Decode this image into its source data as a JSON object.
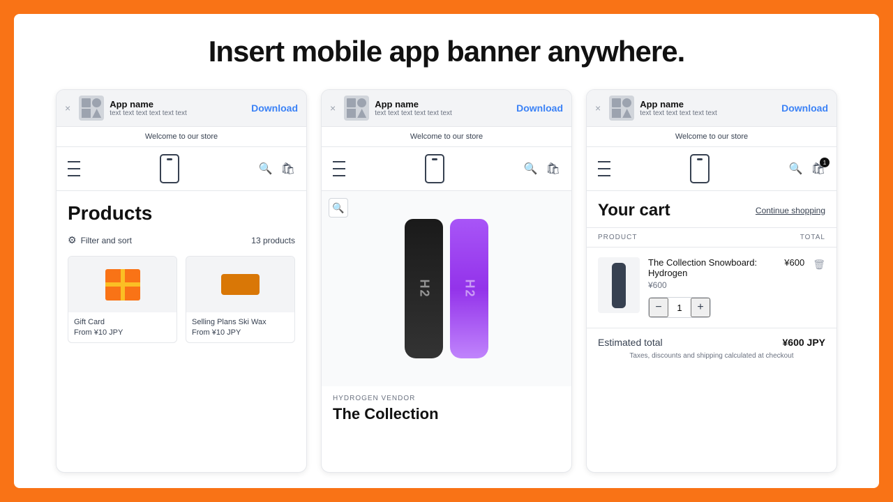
{
  "page": {
    "headline": "Insert mobile app banner anywhere.",
    "background_color": "#f97316"
  },
  "banner": {
    "app_name": "App name",
    "app_desc": "text text text text text text",
    "download_label": "Download",
    "close_symbol": "×"
  },
  "card1": {
    "store_message": "Welcome to our store",
    "products_title": "Products",
    "filter_label": "Filter and sort",
    "products_count": "13 products",
    "items": [
      {
        "name": "Gift Card",
        "price": "From ¥10 JPY"
      },
      {
        "name": "Selling Plans Ski Wax",
        "price": "From ¥10 JPY"
      }
    ]
  },
  "card2": {
    "store_message": "Welcome to our store",
    "vendor": "HYDROGEN VENDOR",
    "product_title": "The Collection"
  },
  "card3": {
    "store_message": "Welcome to our store",
    "cart_title": "Your cart",
    "continue_shopping": "Continue shopping",
    "col_product": "PRODUCT",
    "col_total": "TOTAL",
    "cart_badge": "1",
    "item": {
      "name": "The Collection Snowboard: Hydrogen",
      "price": "¥600",
      "quantity": "1",
      "total": "¥600"
    },
    "estimated_total_label": "Estimated total",
    "estimated_total_value": "¥600 JPY",
    "tax_note": "Taxes, discounts and shipping calculated at checkout"
  }
}
